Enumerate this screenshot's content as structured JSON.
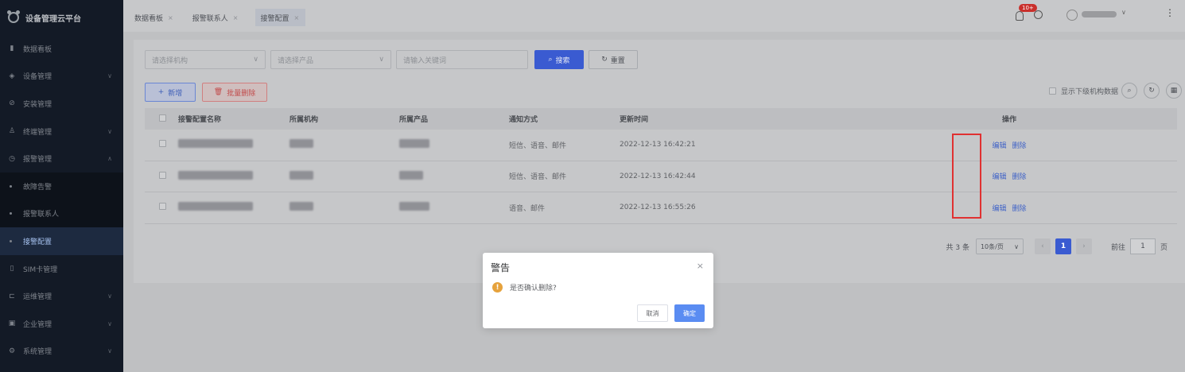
{
  "app": {
    "title": "设备管理云平台"
  },
  "sidebar": {
    "items": [
      {
        "label": "数据看板",
        "icon": "bar-chart-icon"
      },
      {
        "label": "设备管理",
        "icon": "device-icon"
      },
      {
        "label": "安装管理",
        "icon": "install-icon"
      },
      {
        "label": "终端管理",
        "icon": "user-icon"
      },
      {
        "label": "报警管理",
        "icon": "alarm-icon"
      },
      {
        "label": "故障告警"
      },
      {
        "label": "报警联系人"
      },
      {
        "label": "接警配置"
      },
      {
        "label": "SIM卡管理",
        "icon": "sim-icon"
      },
      {
        "label": "运维管理",
        "icon": "ops-icon"
      },
      {
        "label": "企业管理",
        "icon": "enterprise-icon"
      },
      {
        "label": "系统管理",
        "icon": "system-icon"
      }
    ]
  },
  "tabs": [
    {
      "label": "数据看板"
    },
    {
      "label": "报警联系人"
    },
    {
      "label": "接警配置"
    }
  ],
  "header": {
    "badge": "10+"
  },
  "filters": {
    "org_placeholder": "请选择机构",
    "product_placeholder": "请选择产品",
    "keyword_placeholder": "请输入关键词",
    "search_label": "搜索",
    "reset_label": "重置"
  },
  "actions": {
    "add_label": "新增",
    "batch_delete_label": "批量删除",
    "show_sub_label": "显示下级机构数据"
  },
  "table": {
    "headers": {
      "name": "接警配置名称",
      "org": "所属机构",
      "product": "所属产品",
      "notify": "通知方式",
      "time": "更新时间",
      "op": "操作"
    },
    "rows": [
      {
        "notify": "短信、语音、邮件",
        "time": "2022-12-13 16:42:21",
        "edit": "编辑",
        "delete": "删除"
      },
      {
        "notify": "短信、语音、邮件",
        "time": "2022-12-13 16:42:44",
        "edit": "编辑",
        "delete": "删除"
      },
      {
        "notify": "语音、邮件",
        "time": "2022-12-13 16:55:26",
        "edit": "编辑",
        "delete": "删除"
      }
    ]
  },
  "pagination": {
    "total": "共 3 条",
    "page_size": "10条/页",
    "current": "1",
    "goto_label": "前往",
    "goto_value": "1",
    "page_unit": "页"
  },
  "dialog": {
    "title": "警告",
    "message": "是否确认删除?",
    "cancel": "取消",
    "ok": "确定"
  }
}
